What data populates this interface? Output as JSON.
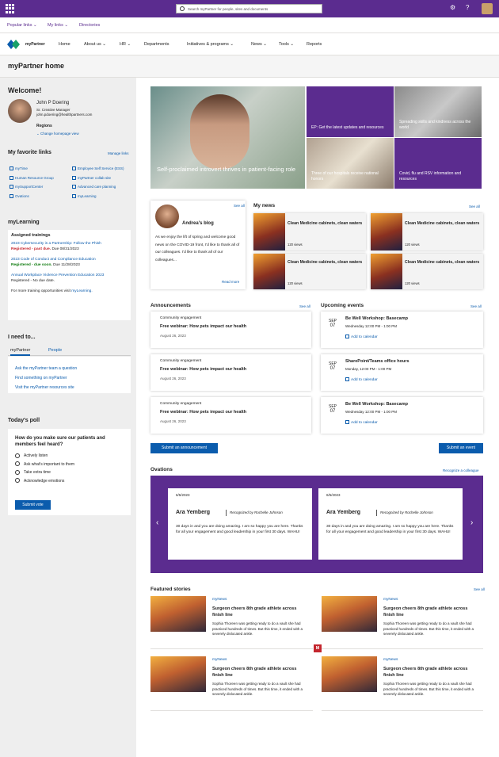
{
  "topbar": {
    "search_placeholder": "Search myPartner for people, sites and documents"
  },
  "subnav": {
    "items": [
      "Popular links",
      "My links",
      "Directories"
    ]
  },
  "site": {
    "name": "myPartner",
    "nav": [
      "Home",
      "About us",
      "HR",
      "Departments",
      "Initiatives & programs",
      "News",
      "Tools",
      "Reports"
    ]
  },
  "page": {
    "title": "myPartner home"
  },
  "welcome": {
    "heading": "Welcome!",
    "name": "John P Doering",
    "role": "Sr. Creative Manager",
    "email": "john.pdoering@healthpartners.com",
    "regions_label": "Regions",
    "change_link": "Change homepage view"
  },
  "favorites": {
    "heading": "My favorite links",
    "manage": "Manage links",
    "links_left": [
      "myTime",
      "Human Resource Group",
      "mySupportCenter",
      "Ovations"
    ],
    "links_right": [
      "Employee Self Service (ESS)",
      "myPartner collab site",
      "Advanced care planning",
      "myLearning"
    ]
  },
  "learning": {
    "heading": "myLearning",
    "sub": "Assigned trainings",
    "items": [
      {
        "title": "2023 Cybersecurity is a Partnership: Follow the Phish",
        "status": "Registered - past due.",
        "due": "Due 08/31/2023"
      },
      {
        "title": "2023 Code of Conduct and Compliance Education",
        "status": "Registered - due soon.",
        "due": "Due 11/28/2023"
      },
      {
        "title": "Annual Workplace Violence Prevention Education 2023",
        "status": "Registered",
        "due": "- No due date."
      }
    ],
    "footer": "For more training opportunities visit",
    "footer_link": "myLearning."
  },
  "ineed": {
    "heading": "I need to...",
    "tabs": [
      "myPartner",
      "People"
    ],
    "links": [
      "Ask the myPartner team a question",
      "Find something on myPartner",
      "Visit the myPartner resources site"
    ]
  },
  "poll": {
    "heading": "Today's poll",
    "question": "How do you make sure our patients and members feel heard?",
    "options": [
      "Actively listen",
      "Ask what's important to them",
      "Take extra time",
      "Acknowledge emotions"
    ],
    "submit": "Submit vote"
  },
  "hero": {
    "caption": "Self-proclaimed introvert thrives in patient-facing role",
    "tiles": [
      "EP: Get the latest updates and resources",
      "Spreading skills and kindness across the world",
      "Three of our hospitals receive national honors",
      "Covid, flu and RSV information and resources"
    ]
  },
  "blog": {
    "see_all": "See all",
    "title": "Andrea's blog",
    "body": "As we enjoy the lift of spring and welcome good news on the COVID-19 front, I'd like to thank all of our colleagues. I'd like to thank all of our colleagues...",
    "read_more": "Read more"
  },
  "news": {
    "heading": "My news",
    "see_all": "See all",
    "items": [
      {
        "title": "Clean Medicine cabinets, clean waters",
        "views": "120 views"
      },
      {
        "title": "Clean Medicine cabinets, clean waters",
        "views": "120 views"
      },
      {
        "title": "Clean Medicine cabinets, clean waters",
        "views": "120 views"
      },
      {
        "title": "Clean Medicine cabinets, clean waters",
        "views": "120 views"
      }
    ]
  },
  "announcements": {
    "heading": "Announcements",
    "see_all": "See all",
    "button": "Submit an announcement",
    "items": [
      {
        "category": "Community engagement",
        "title": "Free webinar: How pets impact our health",
        "date": "August 26, 2023"
      },
      {
        "category": "Community engagement",
        "title": "Free webinar: How pets impact our health",
        "date": "August 26, 2023"
      },
      {
        "category": "Community engagement",
        "title": "Free webinar: How pets impact our health",
        "date": "August 26, 2023"
      }
    ]
  },
  "events": {
    "heading": "Upcoming events",
    "see_all": "See all",
    "button": "Submit an event",
    "add": "Add to calendar",
    "items": [
      {
        "month": "SEP",
        "day": "07",
        "title": "Be Well Workshop: Basecamp",
        "time": "Wednesday 12:00 PM - 1:00 PM"
      },
      {
        "month": "SEP",
        "day": "07",
        "title": "SharePoint/Teams office hours",
        "time": "Monday, 12:00 PM - 1:00 PM"
      },
      {
        "month": "SEP",
        "day": "07",
        "title": "Be Well Workshop: Basecamp",
        "time": "Wednesday 12:00 PM - 1:00 PM"
      }
    ]
  },
  "ovations": {
    "heading": "Ovations",
    "recognize": "Recognize a colleague",
    "cards": [
      {
        "date": "6/5/2023",
        "name": "Ara Yemberg",
        "by": "Recognized by Rochelle Johnson",
        "text": "30 days in and you are doing amazing. I am so happy you are here. Thanks for all your engagement and good leadership in your first 30 days. WAHU!"
      },
      {
        "date": "6/5/2023",
        "name": "Ara Yemberg",
        "by": "Recognized by Rochelle Johnson",
        "text": "30 days in and you are doing amazing. I am so happy you are here. Thanks for all your engagement and good leadership in your first 30 days. WAHU!"
      }
    ]
  },
  "featured": {
    "heading": "Featured stories",
    "see_all": "See all",
    "items": [
      {
        "source": "myNews",
        "title": "Surgeon cheers 8th grade athlete across finish line",
        "body": "Sophia Thoreen was getting ready to do a vault she had practiced hundreds of times. But this time, it ended with a severely dislocated ankle."
      },
      {
        "source": "myNews",
        "title": "Surgeon cheers 8th grade athlete across finish line",
        "body": "Sophia Thoreen was getting ready to do a vault she had practiced hundreds of times. But this time, it ended with a severely dislocated ankle."
      },
      {
        "source": "myNews",
        "title": "Surgeon cheers 8th grade athlete across finish line",
        "body": "Sophia Thoreen was getting ready to do a vault she had practiced hundreds of times. But this time, it ended with a severely dislocated ankle."
      },
      {
        "source": "myNews",
        "title": "Surgeon cheers 8th grade athlete across finish line",
        "body": "Sophia Thoreen was getting ready to do a vault she had practiced hundreds of times. But this time, it ended with a severely dislocated ankle."
      }
    ]
  },
  "badge": "M",
  "colors": {
    "brand": "#5b2c8f",
    "link": "#0b5cad",
    "danger": "#c4262e",
    "success": "#107c10"
  }
}
